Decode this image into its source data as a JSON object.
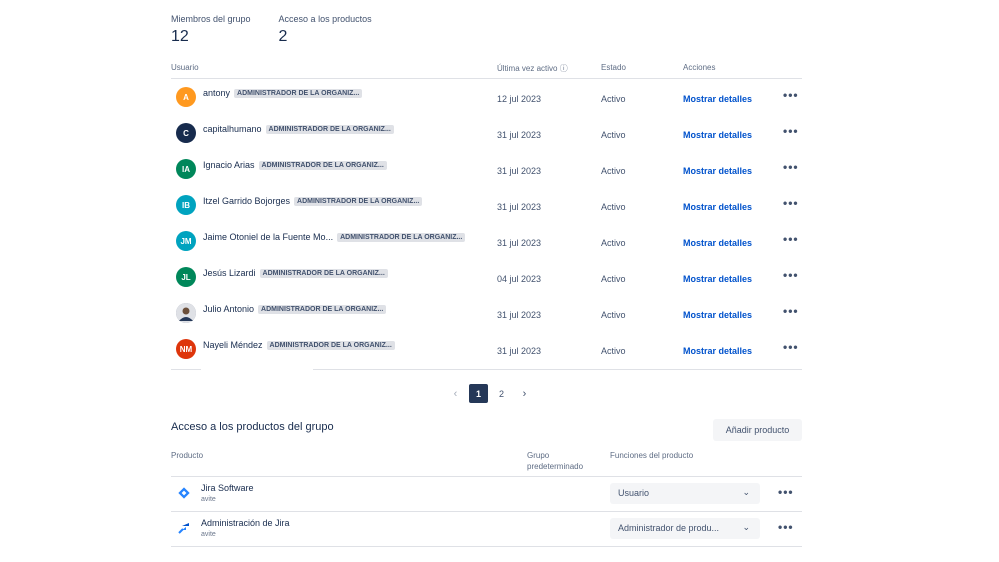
{
  "stats": {
    "members_label": "Miembros del grupo",
    "members_value": "12",
    "products_label": "Acceso a los productos",
    "products_value": "2"
  },
  "users_table": {
    "headers": {
      "user": "Usuario",
      "last_active": "Última vez activo",
      "status": "Estado",
      "actions": "Acciones"
    },
    "rows": [
      {
        "initials": "A",
        "avatar_color": "#ff991f",
        "name": "antony",
        "badge": "ADMINISTRADOR DE LA ORGANIZ...",
        "last_active": "12 jul 2023",
        "status": "Activo",
        "action": "Mostrar detalles"
      },
      {
        "initials": "C",
        "avatar_color": "#172b4d",
        "name": "capitalhumano",
        "badge": "ADMINISTRADOR DE LA ORGANIZ...",
        "last_active": "31 jul 2023",
        "status": "Activo",
        "action": "Mostrar detalles"
      },
      {
        "initials": "IA",
        "avatar_color": "#00875a",
        "name": "Ignacio Arias",
        "badge": "ADMINISTRADOR DE LA ORGANIZ...",
        "last_active": "31 jul 2023",
        "status": "Activo",
        "action": "Mostrar detalles"
      },
      {
        "initials": "IB",
        "avatar_color": "#00a3bf",
        "name": "Itzel Garrido Bojorges",
        "badge": "ADMINISTRADOR DE LA ORGANIZ...",
        "last_active": "31 jul 2023",
        "status": "Activo",
        "action": "Mostrar detalles"
      },
      {
        "initials": "JM",
        "avatar_color": "#00a3bf",
        "name": "Jaime Otoniel de la Fuente Mo...",
        "badge": "ADMINISTRADOR DE LA ORGANIZ...",
        "last_active": "31 jul 2023",
        "status": "Activo",
        "action": "Mostrar detalles"
      },
      {
        "initials": "JL",
        "avatar_color": "#00875a",
        "name": "Jesús Lizardi",
        "badge": "ADMINISTRADOR DE LA ORGANIZ...",
        "last_active": "04 jul 2023",
        "status": "Activo",
        "action": "Mostrar detalles"
      },
      {
        "initials": "",
        "avatar_color": "#8993a4",
        "name": "Julio Antonio",
        "badge": "ADMINISTRADOR DE LA ORGANIZ...",
        "last_active": "31 jul 2023",
        "status": "Activo",
        "action": "Mostrar detalles"
      },
      {
        "initials": "NM",
        "avatar_color": "#de350b",
        "name": "Nayeli Méndez",
        "badge": "ADMINISTRADOR DE LA ORGANIZ...",
        "last_active": "31 jul 2023",
        "status": "Activo",
        "action": "Mostrar detalles"
      }
    ]
  },
  "pagination": {
    "pages": [
      "1",
      "2"
    ],
    "current": "1"
  },
  "products": {
    "title": "Acceso a los productos del grupo",
    "add_button": "Añadir producto",
    "headers": {
      "product": "Producto",
      "default_group_line1": "Grupo",
      "default_group_line2": "predeterminado",
      "roles": "Funciones del producto"
    },
    "rows": [
      {
        "icon": "jira-software-icon",
        "name": "Jira Software",
        "site": "avite",
        "role": "Usuario"
      },
      {
        "icon": "jira-admin-icon",
        "name": "Administración de Jira",
        "site": "avite",
        "role": "Administrador de produ..."
      }
    ]
  },
  "colors": {
    "link": "#0052cc",
    "pager_active": "#253858"
  }
}
